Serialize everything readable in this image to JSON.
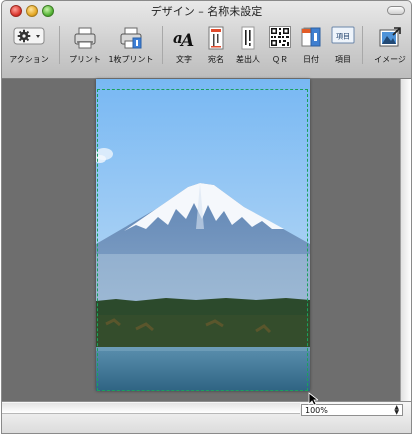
{
  "window": {
    "title": "デザイン – 名称未設定"
  },
  "toolbar": {
    "items": [
      {
        "label": "アクション",
        "icon": "gear-icon"
      },
      {
        "label": "プリント",
        "icon": "printer-icon"
      },
      {
        "label": "1枚プリント",
        "icon": "single-print-icon"
      },
      {
        "label": "文字",
        "icon": "text-aa-icon"
      },
      {
        "label": "宛名",
        "icon": "address-icon"
      },
      {
        "label": "差出人",
        "icon": "sender-icon"
      },
      {
        "label": "ＱＲ",
        "icon": "qr-code-icon"
      },
      {
        "label": "日付",
        "icon": "calendar-icon"
      },
      {
        "label": "項目",
        "icon": "field-icon"
      },
      {
        "label": "イメージ",
        "icon": "image-icon"
      }
    ],
    "field_icon_text": "項目"
  },
  "status": {
    "zoom": "100%"
  },
  "colors": {
    "canvas_bg": "#6e6e6e",
    "guide": "#1aa15c"
  }
}
